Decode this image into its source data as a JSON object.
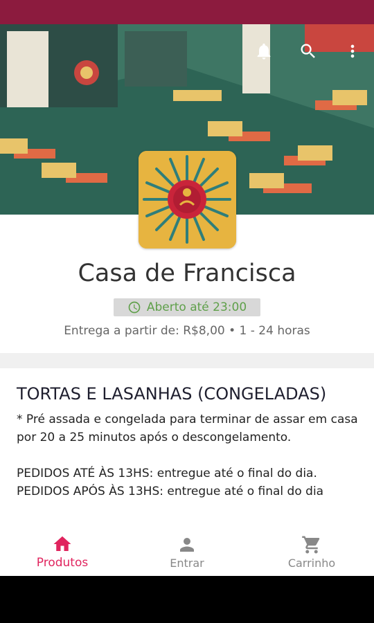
{
  "store": {
    "name": "Casa de Francisca",
    "open_status": "Aberto até 23:00",
    "delivery_info": "Entrega a partir de: R$8,00 • 1 - 24 horas"
  },
  "header_icons": [
    "bell-icon",
    "search-icon",
    "more-vert-icon"
  ],
  "section": {
    "title": "TORTAS E LASANHAS (CONGELADAS)",
    "description": "* Pré assada e congelada para terminar de assar em casa por 20 a 25 minutos após o descongelamento.\n\nPEDIDOS ATÉ ÀS 13HS: entregue até o final do dia.\nPEDIDOS  APÓS ÀS 13HS: entregue até o final do dia"
  },
  "bottom_nav": {
    "products": "Produtos",
    "login": "Entrar",
    "cart": "Carrinho"
  },
  "colors": {
    "status_bar": "#8c1b3e",
    "accent": "#e0245e",
    "open_green": "#5fa04a",
    "logo_bg": "#e7b440"
  }
}
